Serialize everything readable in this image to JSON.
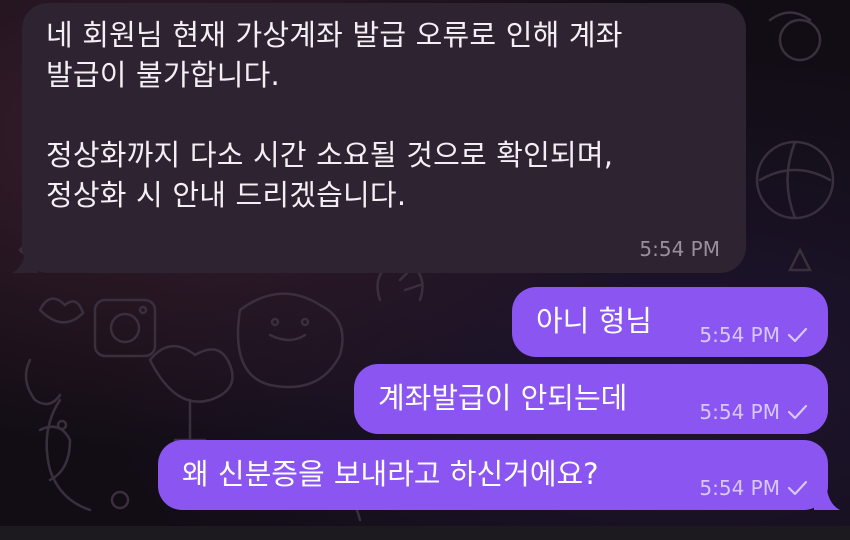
{
  "colors": {
    "background": "#120d15",
    "incoming_bubble": "#2e2330",
    "outgoing_bubble": "#8a55f0",
    "incoming_time": "#9a8f9c",
    "outgoing_time": "#d8c8ff"
  },
  "incoming": {
    "para1_line1": "네 회원님 현재 가상계좌 발급 오류로 인해 계좌",
    "para1_line2": "발급이 불가합니다.",
    "para2_line1": "정상화까지 다소 시간 소요될 것으로 확인되며,",
    "para2_line2": "정상화 시 안내 드리겠습니다.",
    "time": "5:54 PM"
  },
  "outgoing": [
    {
      "text": "아니 형님",
      "time": "5:54 PM",
      "status_icon": "read-check-icon"
    },
    {
      "text": "계좌발급이 안되는데",
      "time": "5:54 PM",
      "status_icon": "read-check-icon"
    },
    {
      "text": "왜 신분증을 보내라고 하신거에요?",
      "time": "5:54 PM",
      "status_icon": "read-check-icon"
    }
  ]
}
